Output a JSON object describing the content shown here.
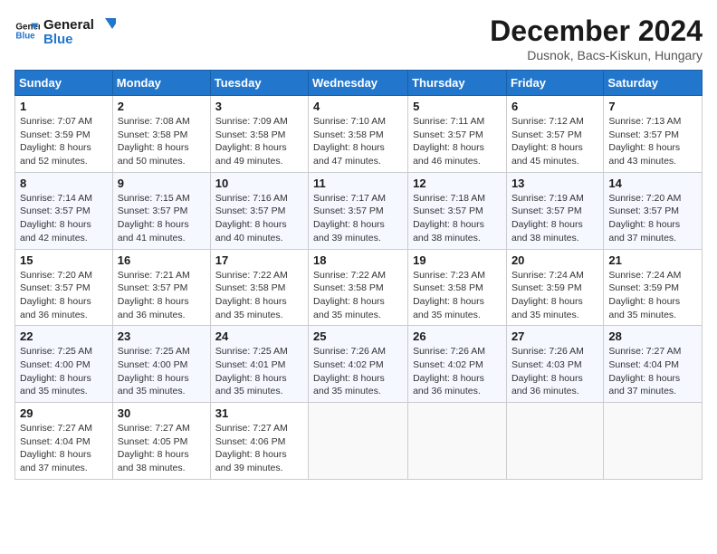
{
  "logo": {
    "line1": "General",
    "line2": "Blue"
  },
  "title": "December 2024",
  "location": "Dusnok, Bacs-Kiskun, Hungary",
  "days_of_week": [
    "Sunday",
    "Monday",
    "Tuesday",
    "Wednesday",
    "Thursday",
    "Friday",
    "Saturday"
  ],
  "weeks": [
    [
      {
        "day": "1",
        "sunrise": "7:07 AM",
        "sunset": "3:59 PM",
        "daylight": "8 hours and 52 minutes."
      },
      {
        "day": "2",
        "sunrise": "7:08 AM",
        "sunset": "3:58 PM",
        "daylight": "8 hours and 50 minutes."
      },
      {
        "day": "3",
        "sunrise": "7:09 AM",
        "sunset": "3:58 PM",
        "daylight": "8 hours and 49 minutes."
      },
      {
        "day": "4",
        "sunrise": "7:10 AM",
        "sunset": "3:58 PM",
        "daylight": "8 hours and 47 minutes."
      },
      {
        "day": "5",
        "sunrise": "7:11 AM",
        "sunset": "3:57 PM",
        "daylight": "8 hours and 46 minutes."
      },
      {
        "day": "6",
        "sunrise": "7:12 AM",
        "sunset": "3:57 PM",
        "daylight": "8 hours and 45 minutes."
      },
      {
        "day": "7",
        "sunrise": "7:13 AM",
        "sunset": "3:57 PM",
        "daylight": "8 hours and 43 minutes."
      }
    ],
    [
      {
        "day": "8",
        "sunrise": "7:14 AM",
        "sunset": "3:57 PM",
        "daylight": "8 hours and 42 minutes."
      },
      {
        "day": "9",
        "sunrise": "7:15 AM",
        "sunset": "3:57 PM",
        "daylight": "8 hours and 41 minutes."
      },
      {
        "day": "10",
        "sunrise": "7:16 AM",
        "sunset": "3:57 PM",
        "daylight": "8 hours and 40 minutes."
      },
      {
        "day": "11",
        "sunrise": "7:17 AM",
        "sunset": "3:57 PM",
        "daylight": "8 hours and 39 minutes."
      },
      {
        "day": "12",
        "sunrise": "7:18 AM",
        "sunset": "3:57 PM",
        "daylight": "8 hours and 38 minutes."
      },
      {
        "day": "13",
        "sunrise": "7:19 AM",
        "sunset": "3:57 PM",
        "daylight": "8 hours and 38 minutes."
      },
      {
        "day": "14",
        "sunrise": "7:20 AM",
        "sunset": "3:57 PM",
        "daylight": "8 hours and 37 minutes."
      }
    ],
    [
      {
        "day": "15",
        "sunrise": "7:20 AM",
        "sunset": "3:57 PM",
        "daylight": "8 hours and 36 minutes."
      },
      {
        "day": "16",
        "sunrise": "7:21 AM",
        "sunset": "3:57 PM",
        "daylight": "8 hours and 36 minutes."
      },
      {
        "day": "17",
        "sunrise": "7:22 AM",
        "sunset": "3:58 PM",
        "daylight": "8 hours and 35 minutes."
      },
      {
        "day": "18",
        "sunrise": "7:22 AM",
        "sunset": "3:58 PM",
        "daylight": "8 hours and 35 minutes."
      },
      {
        "day": "19",
        "sunrise": "7:23 AM",
        "sunset": "3:58 PM",
        "daylight": "8 hours and 35 minutes."
      },
      {
        "day": "20",
        "sunrise": "7:24 AM",
        "sunset": "3:59 PM",
        "daylight": "8 hours and 35 minutes."
      },
      {
        "day": "21",
        "sunrise": "7:24 AM",
        "sunset": "3:59 PM",
        "daylight": "8 hours and 35 minutes."
      }
    ],
    [
      {
        "day": "22",
        "sunrise": "7:25 AM",
        "sunset": "4:00 PM",
        "daylight": "8 hours and 35 minutes."
      },
      {
        "day": "23",
        "sunrise": "7:25 AM",
        "sunset": "4:00 PM",
        "daylight": "8 hours and 35 minutes."
      },
      {
        "day": "24",
        "sunrise": "7:25 AM",
        "sunset": "4:01 PM",
        "daylight": "8 hours and 35 minutes."
      },
      {
        "day": "25",
        "sunrise": "7:26 AM",
        "sunset": "4:02 PM",
        "daylight": "8 hours and 35 minutes."
      },
      {
        "day": "26",
        "sunrise": "7:26 AM",
        "sunset": "4:02 PM",
        "daylight": "8 hours and 36 minutes."
      },
      {
        "day": "27",
        "sunrise": "7:26 AM",
        "sunset": "4:03 PM",
        "daylight": "8 hours and 36 minutes."
      },
      {
        "day": "28",
        "sunrise": "7:27 AM",
        "sunset": "4:04 PM",
        "daylight": "8 hours and 37 minutes."
      }
    ],
    [
      {
        "day": "29",
        "sunrise": "7:27 AM",
        "sunset": "4:04 PM",
        "daylight": "8 hours and 37 minutes."
      },
      {
        "day": "30",
        "sunrise": "7:27 AM",
        "sunset": "4:05 PM",
        "daylight": "8 hours and 38 minutes."
      },
      {
        "day": "31",
        "sunrise": "7:27 AM",
        "sunset": "4:06 PM",
        "daylight": "8 hours and 39 minutes."
      },
      null,
      null,
      null,
      null
    ]
  ],
  "labels": {
    "sunrise": "Sunrise:",
    "sunset": "Sunset:",
    "daylight": "Daylight:"
  }
}
